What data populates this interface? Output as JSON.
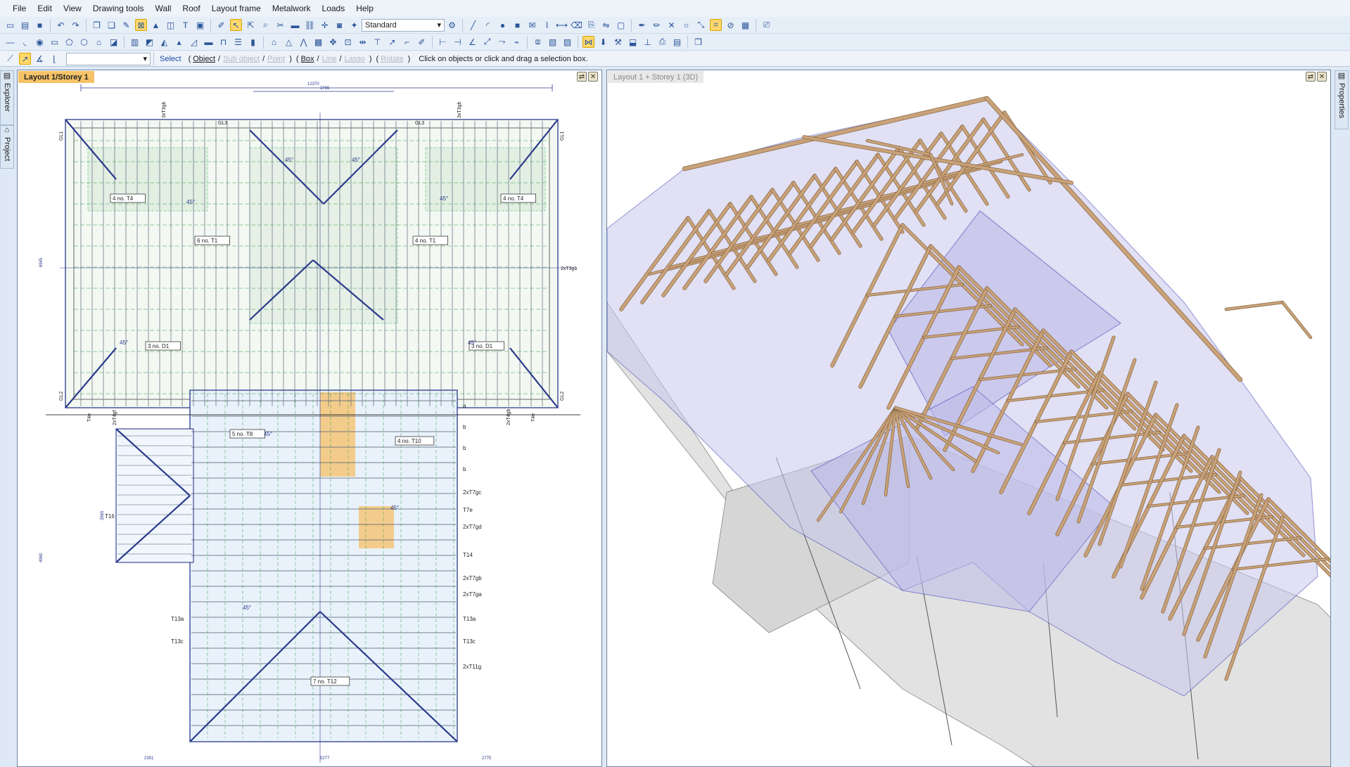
{
  "menu": [
    "File",
    "Edit",
    "View",
    "Drawing tools",
    "Wall",
    "Roof",
    "Layout frame",
    "Metalwork",
    "Loads",
    "Help"
  ],
  "toolbar": {
    "style_combo": "Standard"
  },
  "status": {
    "select": "Select",
    "object": "Object",
    "sub_object": "Sub object",
    "point": "Point",
    "box": "Box",
    "line": "Line",
    "lasso": "Lasso",
    "rotate": "Rotate",
    "hint": "Click on objects or click and drag a selection box."
  },
  "side_tabs": {
    "explorer": "Explorer",
    "project": "Project",
    "properties": "Properties"
  },
  "left_pane": {
    "title": "Layout 1/Storey 1"
  },
  "right_pane": {
    "title": "Layout 1 + Storey 1 (3D)"
  },
  "plan_labels": {
    "beams": [
      "4 no. T4",
      "6 no. T1",
      "4 no. T1",
      "4 no. T4",
      "3 no. D1",
      "3 no. D1",
      "5 no. T8",
      "4 no. T10",
      "7 no. T12"
    ],
    "angles": [
      "45°",
      "45°",
      "45°",
      "45°",
      "45°",
      "45°",
      "45°",
      "45°",
      "45°"
    ],
    "right_side": [
      "a",
      "b",
      "b",
      "b",
      "2xT7gc",
      "T7e",
      "2xT7gd",
      "T14",
      "2xT7gb",
      "2xT7ga",
      "T13a",
      "T13c",
      "2xT11g"
    ],
    "left_side": [
      "T16",
      "T13a",
      "T13c"
    ],
    "top": [
      "GL3",
      "GL3",
      "3xT3gb",
      "3xT3gb",
      "GL1",
      "GL1"
    ],
    "bottom": [
      "T4e",
      "2xT4gf",
      "2xT4gb",
      "T4e",
      "GL2",
      "GL2"
    ],
    "mid": [
      "2xT3gb"
    ],
    "dims": [
      "12370",
      "3765",
      "6945",
      "4960",
      "3565",
      "2351",
      "5277",
      "2775"
    ]
  }
}
